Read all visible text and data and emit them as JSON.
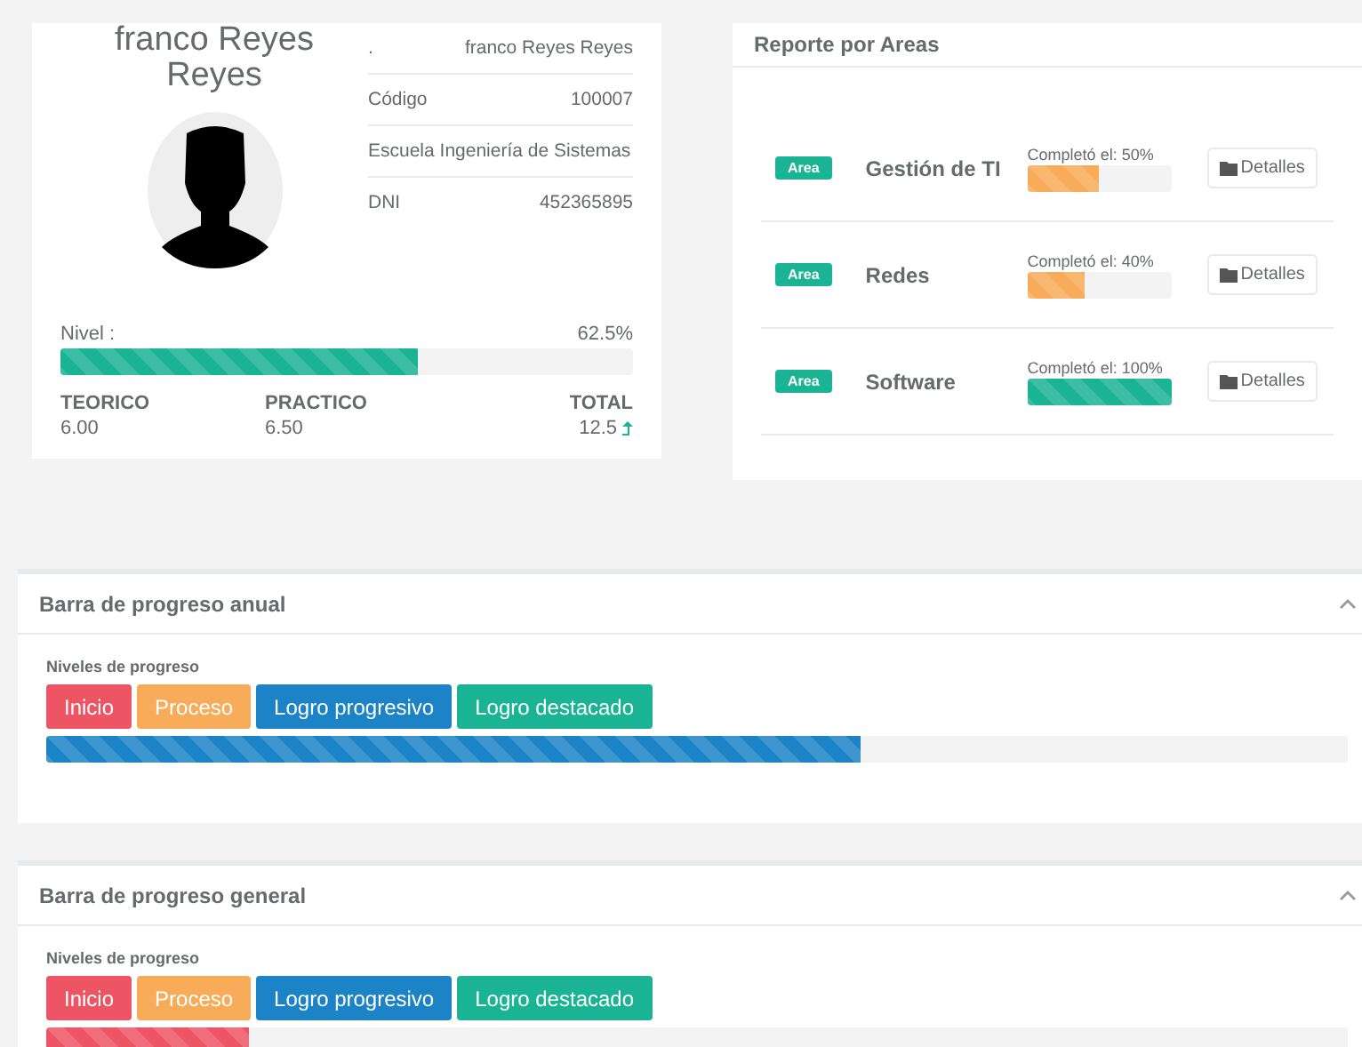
{
  "profile": {
    "name": "franco Reyes Reyes",
    "info": [
      {
        "label": ".",
        "value": "franco Reyes Reyes"
      },
      {
        "label": "Código",
        "value": "100007"
      },
      {
        "label": "Escuela Ingeniería de Sistemas"
      },
      {
        "label": "DNI",
        "value": "452365895"
      }
    ],
    "level_label": "Nivel :",
    "level_reading": "62.5%",
    "level": 0.625,
    "scores": [
      {
        "label": "TEORICO",
        "value": "6.00"
      },
      {
        "label": "PRACTICO",
        "value": "6.50"
      },
      {
        "label": "TOTAL",
        "value": "12.5"
      }
    ]
  },
  "areas_report": {
    "title": "Reporte por Areas",
    "areas": [
      {
        "badge": "Area",
        "name": "Gestión de TI",
        "caption": "Completó el: 50%",
        "level": 0.5,
        "color": "#f8ac59",
        "button": "Detalles"
      },
      {
        "badge": "Area",
        "name": "Redes",
        "caption": "Completó el: 40%",
        "level": 0.4,
        "color": "#f8ac59",
        "button": "Detalles"
      },
      {
        "badge": "Area",
        "name": "Software",
        "caption": "Completó el: 100%",
        "level": 1,
        "color": "#1ab394",
        "button": "Detalles"
      }
    ]
  },
  "panels": [
    {
      "title": "Barra de progreso anual",
      "label": "Niveles de progreso",
      "levels": [
        {
          "label": "Inicio",
          "color": "#ed5565"
        },
        {
          "label": "Proceso",
          "color": "#f8ac59"
        },
        {
          "label": "Logro progresivo",
          "color": "#1c84c6"
        },
        {
          "label": "Logro destacado",
          "color": "#1ab394"
        }
      ],
      "level": 0.626,
      "color": "#1c84c6"
    },
    {
      "title": "Barra de progreso general",
      "label": "Niveles de progreso",
      "levels": [
        {
          "label": "Inicio",
          "color": "#ed5565"
        },
        {
          "label": "Proceso",
          "color": "#f8ac59"
        },
        {
          "label": "Logro progresivo",
          "color": "#1c84c6"
        },
        {
          "label": "Logro destacado",
          "color": "#1ab394"
        }
      ],
      "level": 0.156,
      "color": "#ed5565"
    }
  ]
}
